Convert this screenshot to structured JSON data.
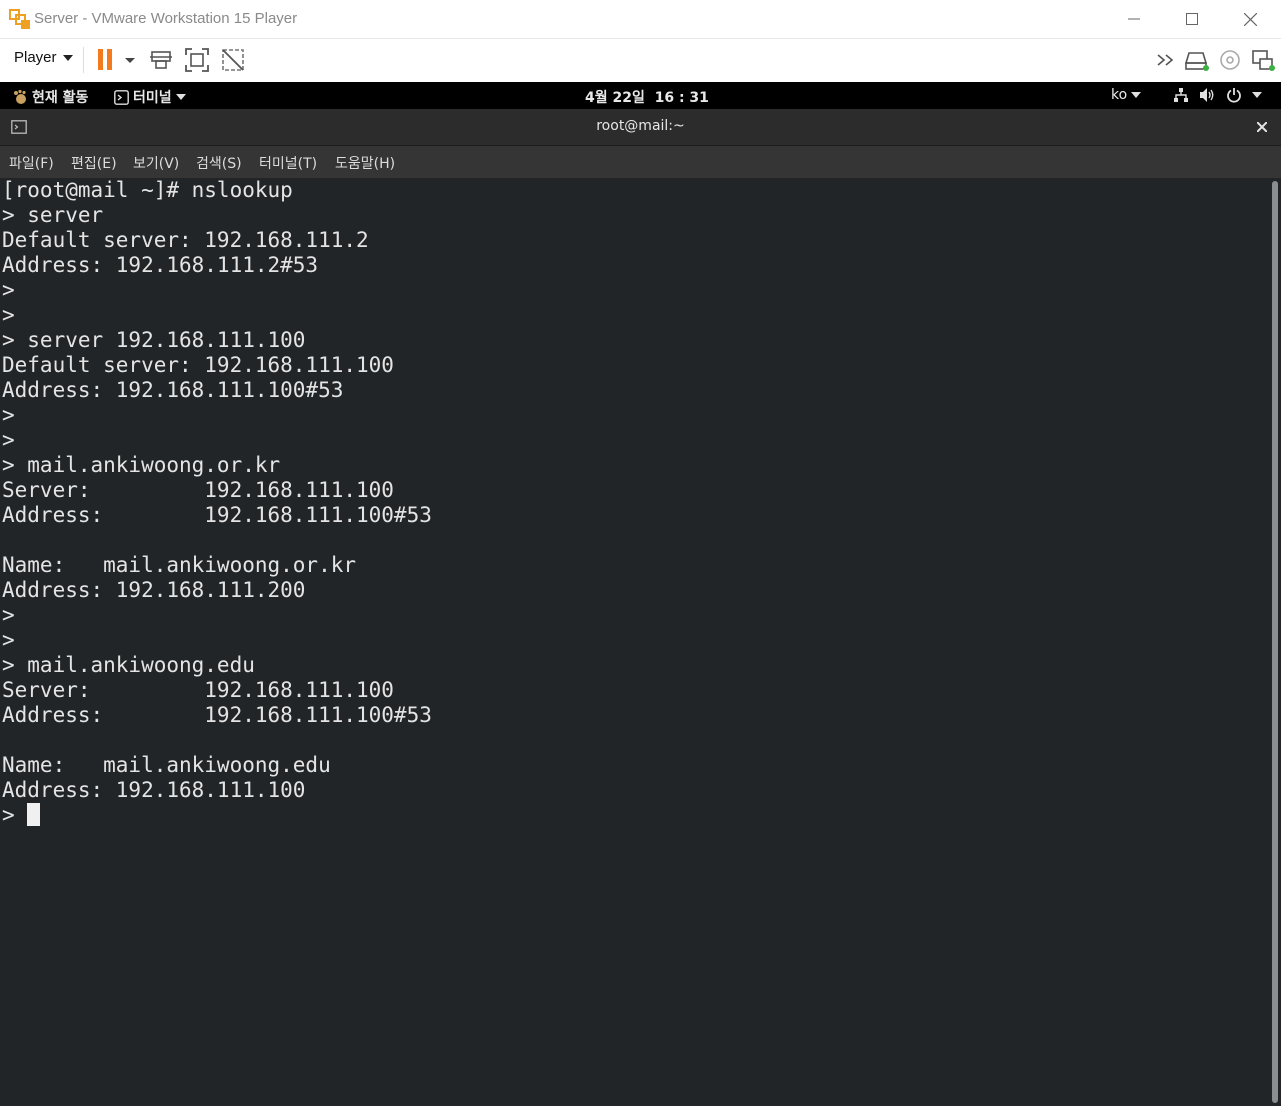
{
  "window": {
    "title": "Server - VMware Workstation 15 Player"
  },
  "toolbar": {
    "player_menu": "Player"
  },
  "gnome": {
    "activities": "현재 활동",
    "app_menu": "터미널",
    "clock": "4월 22일  16 : 31",
    "keyboard": "ko"
  },
  "terminal": {
    "title": "root@mail:~",
    "menu": [
      "파일(F)",
      "편집(E)",
      "보기(V)",
      "검색(S)",
      "터미널(T)",
      "도움말(H)"
    ],
    "lines": [
      "[root@mail ~]# nslookup",
      "> server",
      "Default server: 192.168.111.2",
      "Address: 192.168.111.2#53",
      ">",
      ">",
      "> server 192.168.111.100",
      "Default server: 192.168.111.100",
      "Address: 192.168.111.100#53",
      ">",
      ">",
      "> mail.ankiwoong.or.kr",
      "Server:         192.168.111.100",
      "Address:        192.168.111.100#53",
      "",
      "Name:   mail.ankiwoong.or.kr",
      "Address: 192.168.111.200",
      ">",
      ">",
      "> mail.ankiwoong.edu",
      "Server:         192.168.111.100",
      "Address:        192.168.111.100#53",
      "",
      "Name:   mail.ankiwoong.edu",
      "Address: 192.168.111.100"
    ],
    "prompt": "> "
  },
  "colors": {
    "pause_accent": "#f47a20",
    "terminal_bg": "#222528"
  }
}
